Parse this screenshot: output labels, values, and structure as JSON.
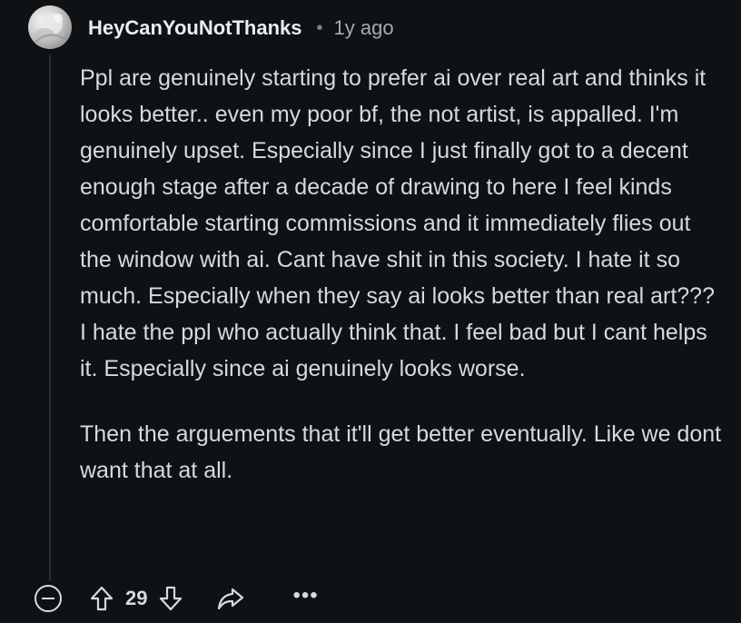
{
  "comment": {
    "username": "HeyCanYouNotThanks",
    "separator": "•",
    "timestamp": "1y ago",
    "paragraphs": [
      "Ppl are genuinely starting to prefer ai over real art and thinks it looks better.. even my poor bf, the not artist, is appalled. I'm genuinely upset. Especially since I just finally got to a decent enough stage after a decade of drawing to here I feel kinds comfortable starting commissions and it immediately flies out the window with ai. Cant have shit in this society. I hate it so much. Especially when they say ai looks better than real art??? I hate the ppl who actually think that. I feel bad but I cant helps it. Especially since ai genuinely looks worse.",
      "Then the arguements that it'll get better eventually. Like we dont want that at all."
    ]
  },
  "actions": {
    "vote_count": "29",
    "more_label": "•••",
    "icons": {
      "collapse": "collapse-icon",
      "upvote": "upvote-arrow-icon",
      "downvote": "downvote-arrow-icon",
      "share": "share-icon",
      "more": "more-options-icon"
    }
  },
  "colors": {
    "background": "#0f1214",
    "text": "#d7dadc",
    "muted": "#a7abad",
    "thread_line": "#343536"
  }
}
